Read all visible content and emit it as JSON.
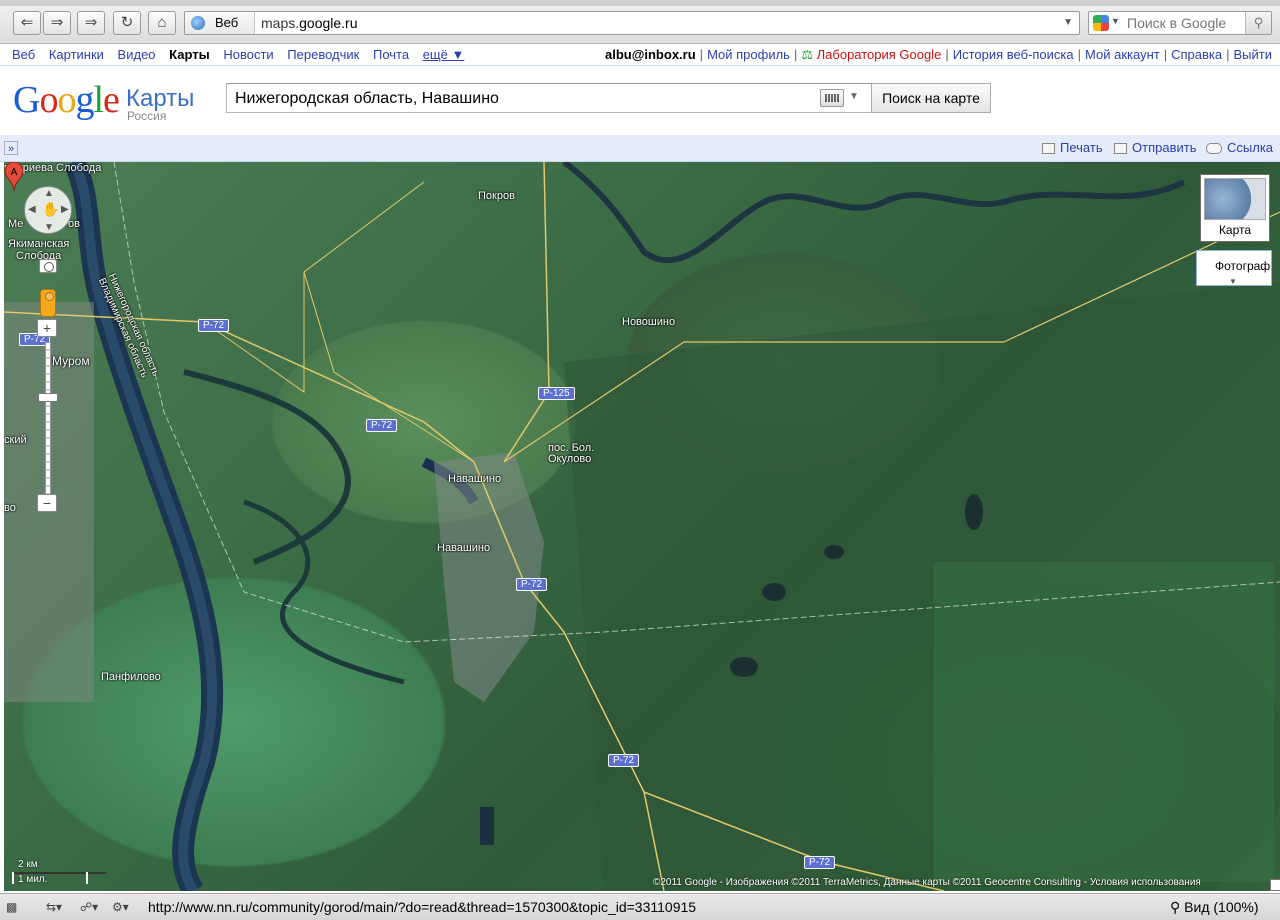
{
  "browser": {
    "scope_label": "Веб",
    "url_domain_prefix": "maps.",
    "url_domain": "google.ru",
    "search_placeholder": "Поиск в Google",
    "status_url": "http://www.nn.ru/community/gorod/main/?do=read&thread=1570300&topic_id=33110915",
    "zoom_label": "Вид (100%)"
  },
  "gbar": {
    "left": [
      "Веб",
      "Картинки",
      "Видео",
      "Карты",
      "Новости",
      "Переводчик",
      "Почта",
      "ещё ▼"
    ],
    "current": "Карты",
    "user": "albu@inbox.ru",
    "right": [
      "Мой профиль",
      "Лаборатория Google",
      "История веб-поиска",
      "Мой аккаунт",
      "Справка",
      "Выйти"
    ]
  },
  "header": {
    "product": "Карты",
    "region": "Россия",
    "query": "Нижегородская область, Навашино",
    "search_button": "Поиск на карте"
  },
  "linkbar": {
    "print": "Печать",
    "send": "Отправить",
    "link": "Ссылка"
  },
  "map": {
    "places": {
      "pokrov": "Покров",
      "novoshino": "Новошино",
      "bol_okulovo": "пос. Бол.\nОкулово",
      "navashino_marker": "Навашино",
      "navashino_town": "Навашино",
      "panfilovo": "Панфилово",
      "murom": "Муром",
      "yakimanskaya": "Якиманская\nСлобода",
      "dmitrieva": "митриева\nСлобода",
      "mel": "Ме",
      "ov": "ов",
      "skiy": "ский",
      "vo": "во",
      "region_border": "Нижегородская область\nВладимирская область"
    },
    "roads": {
      "r72_a": "Р-72",
      "r72_b": "Р-72",
      "r72_c": "Р-72",
      "r72_d": "Р-72",
      "r72_e": "Р-72",
      "r72_f": "Р-72",
      "r125": "Р-125"
    },
    "marker_letter": "A",
    "map_type_label": "Карта",
    "photo_label": "Фотографии",
    "scale_km": "2 км",
    "scale_mi": "1 мил.",
    "copyright": "©2011 Google - Изображения ©2011 TerraMetrics, Данные карты ©2011 Geocentre Consulting - Условия использования"
  }
}
